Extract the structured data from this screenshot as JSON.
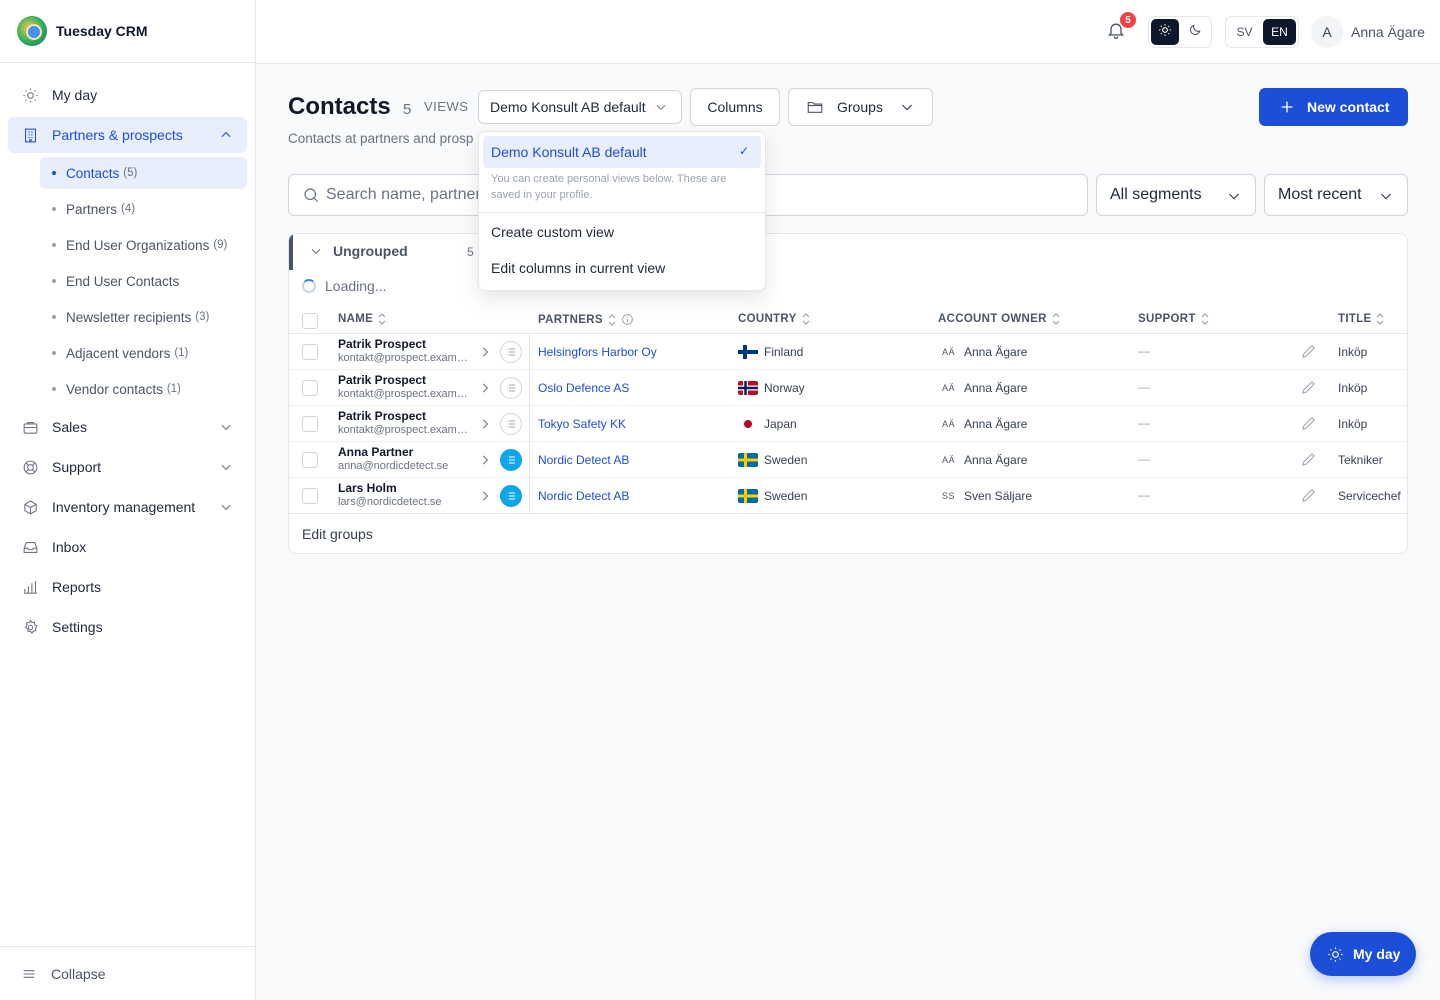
{
  "app": {
    "name": "Tuesday CRM"
  },
  "sidebar": {
    "items": [
      {
        "label": "My day",
        "icon": "sun-icon"
      },
      {
        "label": "Partners & prospects",
        "icon": "building-icon",
        "active": true,
        "expanded": true
      },
      {
        "label": "Sales",
        "icon": "briefcase-icon"
      },
      {
        "label": "Support",
        "icon": "lifebuoy-icon"
      },
      {
        "label": "Inventory management",
        "icon": "box-icon"
      },
      {
        "label": "Inbox",
        "icon": "inbox-icon"
      },
      {
        "label": "Reports",
        "icon": "bar-chart-icon"
      },
      {
        "label": "Settings",
        "icon": "gear-icon"
      }
    ],
    "subitems": [
      {
        "label": "Contacts",
        "count": "(5)",
        "active": true
      },
      {
        "label": "Partners",
        "count": "(4)"
      },
      {
        "label": "End User Organizations",
        "count": "(9)"
      },
      {
        "label": "End User Contacts",
        "count": ""
      },
      {
        "label": "Newsletter recipients",
        "count": "(3)"
      },
      {
        "label": "Adjacent vendors",
        "count": "(1)"
      },
      {
        "label": "Vendor contacts",
        "count": "(1)"
      }
    ],
    "collapse_label": "Collapse"
  },
  "topbar": {
    "notification_count": "5",
    "lang_sv": "SV",
    "lang_en": "EN",
    "user_initial": "A",
    "user_name": "Anna Ägare"
  },
  "page": {
    "title": "Contacts",
    "count": "5",
    "views_label": "VIEWS",
    "subtitle": "Contacts at partners and prosp",
    "view_selected": "Demo Konsult AB default",
    "columns_label": "Columns",
    "groups_label": "Groups",
    "new_contact_label": "New contact"
  },
  "filters": {
    "search_placeholder": "Search name, partner",
    "segment": "All segments",
    "sort": "Most recent"
  },
  "dropdown": {
    "selected": "Demo Konsult AB default",
    "check": "✓",
    "note": "You can create personal views below. These are saved in your profile.",
    "create_view": "Create custom view",
    "edit_columns": "Edit columns in current view"
  },
  "table": {
    "group_name": "Ungrouped",
    "group_count": "5",
    "loading": "Loading...",
    "headers": {
      "name": "NAME",
      "partners": "PARTNERS",
      "country": "COUNTRY",
      "owner": "ACCOUNT OWNER",
      "support": "SUPPORT",
      "title": "TITLE"
    },
    "rows": [
      {
        "name": "Patrik Prospect",
        "email": "kontakt@prospect.example",
        "partner": "Helsingfors Harbor Oy",
        "country": "Finland",
        "flag": "fi",
        "owner_initials": "AÄ",
        "owner": "Anna Ägare",
        "support": "—",
        "title": "Inköp",
        "list_active": false
      },
      {
        "name": "Patrik Prospect",
        "email": "kontakt@prospect.example",
        "partner": "Oslo Defence AS",
        "country": "Norway",
        "flag": "no",
        "owner_initials": "AÄ",
        "owner": "Anna Ägare",
        "support": "—",
        "title": "Inköp",
        "list_active": false
      },
      {
        "name": "Patrik Prospect",
        "email": "kontakt@prospect.example",
        "partner": "Tokyo Safety KK",
        "country": "Japan",
        "flag": "jp",
        "owner_initials": "AÄ",
        "owner": "Anna Ägare",
        "support": "—",
        "title": "Inköp",
        "list_active": false
      },
      {
        "name": "Anna Partner",
        "email": "anna@nordicdetect.se",
        "partner": "Nordic Detect AB",
        "country": "Sweden",
        "flag": "se",
        "owner_initials": "AÄ",
        "owner": "Anna Ägare",
        "support": "—",
        "title": "Tekniker",
        "list_active": true
      },
      {
        "name": "Lars Holm",
        "email": "lars@nordicdetect.se",
        "partner": "Nordic Detect AB",
        "country": "Sweden",
        "flag": "se",
        "owner_initials": "SS",
        "owner": "Sven Säljare",
        "support": "—",
        "title": "Servicechef",
        "list_active": true
      }
    ],
    "edit_groups": "Edit groups"
  },
  "fab": {
    "label": "My day"
  },
  "colors": {
    "accent": "#1d4ed8",
    "active_bg": "#e8eefb",
    "badge": "#ef4444",
    "list_icon_active": "#0ea5e9"
  }
}
